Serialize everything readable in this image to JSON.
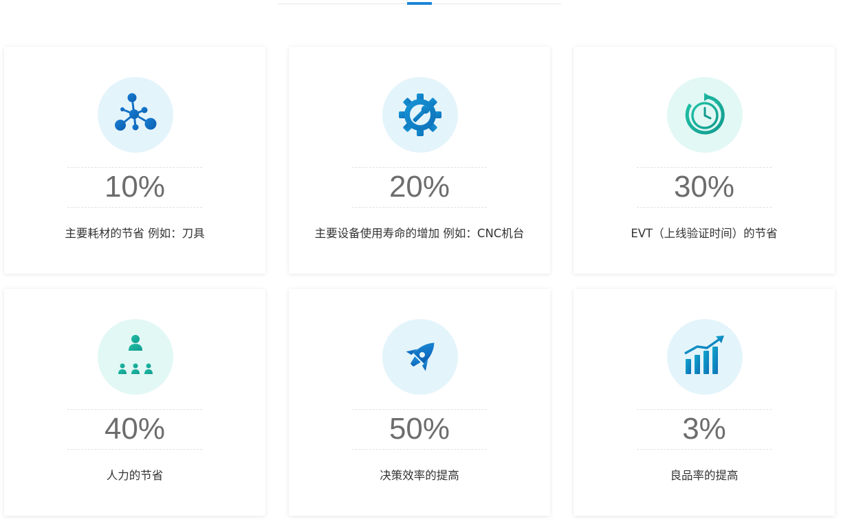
{
  "cards": [
    {
      "icon": "network-nodes-icon",
      "value": "10%",
      "label": "主要耗材的节省 例如：刀具"
    },
    {
      "icon": "gear-wrench-icon",
      "value": "20%",
      "label": "主要设备使用寿命的增加 例如：CNC机台"
    },
    {
      "icon": "clock-refresh-icon",
      "value": "30%",
      "label": "EVT（上线验证时间）的节省"
    },
    {
      "icon": "org-chart-icon",
      "value": "40%",
      "label": "人力的节省"
    },
    {
      "icon": "rocket-icon",
      "value": "50%",
      "label": "决策效率的提高"
    },
    {
      "icon": "growth-bar-chart-icon",
      "value": "3%",
      "label": "良品率的提高"
    }
  ],
  "colors": {
    "accent": "#1a85d6",
    "icon_blue": "#0f7fc9",
    "icon_teal": "#19b7a4",
    "value_text": "#6d6d6d",
    "label_text": "#333333"
  }
}
